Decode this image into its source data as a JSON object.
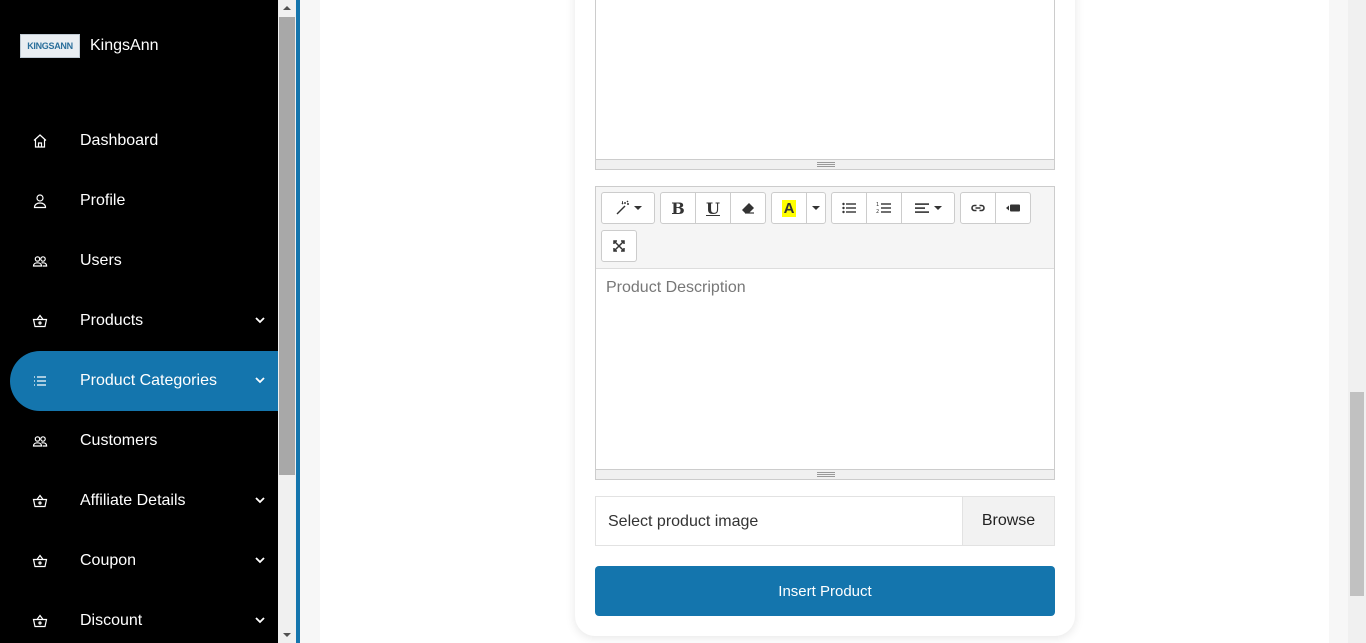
{
  "brand": {
    "logo_text": "KINGSANN",
    "name": "KingsAnn"
  },
  "sidebar": {
    "items": [
      {
        "label": "Dashboard",
        "icon": "home-icon",
        "chevron": false
      },
      {
        "label": "Profile",
        "icon": "user-icon",
        "chevron": false
      },
      {
        "label": "Users",
        "icon": "users-icon",
        "chevron": false
      },
      {
        "label": "Products",
        "icon": "basket-icon",
        "chevron": true
      },
      {
        "label": "Product Categories",
        "icon": "list-icon",
        "chevron": true,
        "active": true
      },
      {
        "label": "Customers",
        "icon": "users-icon",
        "chevron": false
      },
      {
        "label": "Affiliate Details",
        "icon": "basket-icon",
        "chevron": true
      },
      {
        "label": "Coupon",
        "icon": "basket-icon",
        "chevron": true
      },
      {
        "label": "Discount",
        "icon": "basket-icon",
        "chevron": true
      }
    ]
  },
  "editor": {
    "placeholder": "Product Description",
    "toolbar": [
      "magic-style-icon",
      "bold-icon",
      "underline-icon",
      "eraser-icon",
      "highlight-icon",
      "bullet-list-icon",
      "numbered-list-icon",
      "align-icon",
      "link-icon",
      "video-icon",
      "fullscreen-icon"
    ]
  },
  "file_input": {
    "placeholder": "Select product image",
    "button": "Browse"
  },
  "submit": {
    "label": "Insert Product"
  },
  "colors": {
    "accent": "#1475ad",
    "sidebar": "#000000"
  }
}
